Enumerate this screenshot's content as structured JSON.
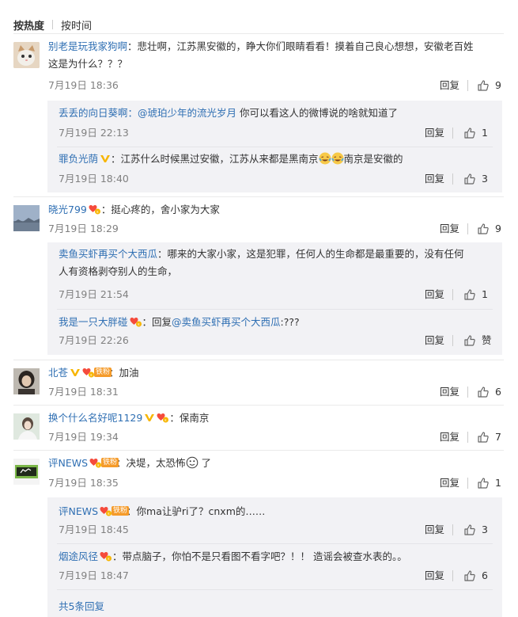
{
  "sort_tabs": {
    "hot": "按热度",
    "time": "按时间"
  },
  "actions": {
    "reply": "回复"
  },
  "comments": [
    {
      "name": "别老是玩我家狗啊",
      "text_1": "：悲壮啊，江苏黑安徽的，睁大你们眼睛看看！摸着自己良心想想，安徽老百姓",
      "text_2": "这是为什么？？？",
      "time": "7月19日 18:36",
      "likes": "9"
    },
    {
      "name": "晓光799",
      "text": "：挺心疼的，舍小家为大家",
      "time": "7月19日 18:29",
      "likes": "9"
    },
    {
      "name": "北苍",
      "fan_label": "铁粉",
      "text": "：加油",
      "time": "7月19日 18:31",
      "likes": "6"
    },
    {
      "name": "换个什么名好呢1129",
      "text": "：保南京",
      "time": "7月19日 19:34",
      "likes": "7"
    },
    {
      "name": "评NEWS",
      "fan_label": "铁粉",
      "text_a": "：决堤，太恐怖",
      "text_b": " 了",
      "time": "7月19日 18:35",
      "likes": "1"
    }
  ],
  "replies": [
    {
      "name": "丢丢的向日葵啊",
      "mention": "：@琥珀少年的流光岁月",
      "text": " 你可以看这人的微博说的啥就知道了",
      "time": "7月19日 22:13",
      "likes": "1"
    },
    {
      "name": "罪负光荫",
      "text_a": "：江苏什么时候黑过安徽，江苏从来都是黑南京",
      "text_b": "南京是安徽的",
      "time": "7月19日 18:40",
      "likes": "3"
    },
    {
      "name": "卖鱼买虾再买个大西瓜",
      "text_1": "：哪来的大家小家，这是犯罪，任何人的生命都是最重要的，没有任何",
      "text_2": "人有资格剥夺别人的生命，",
      "time": "7月19日 21:54",
      "likes": "1"
    },
    {
      "name": "我是一只大胖碰",
      "text_a": "：回复",
      "mention": "@卖鱼买虾再买个大西瓜",
      "text_b": ":???",
      "time": "7月19日 22:26",
      "likes": "赞"
    },
    {
      "name": "评NEWS",
      "fan_label": "铁粉",
      "text": "：你ma让驴ri了？cnxm的……",
      "time": "7月19日 18:45",
      "likes": "3"
    },
    {
      "name": "烟途风径",
      "text": "：带点脑子，你怕不是只看图不看字吧？！！ 造谣会被查水表的。。",
      "time": "7月19日 18:47",
      "likes": "6"
    }
  ],
  "more_replies": "共5条回复",
  "colors": {
    "link": "#2f6fb3",
    "reply_bg": "#f2f2f5",
    "vip": "#f7b500",
    "member": "#f54b3c",
    "fan": "#f59b2a"
  }
}
